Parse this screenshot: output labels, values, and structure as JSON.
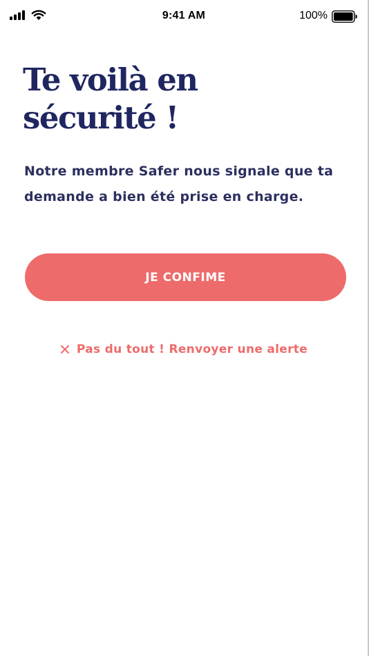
{
  "status_bar": {
    "time": "9:41 AM",
    "battery_percent": "100%",
    "icons": [
      "signal-icon",
      "wifi-icon",
      "battery-icon"
    ]
  },
  "main": {
    "title_line1": "Te voilà en",
    "title_line2": "sécurité !",
    "subtitle": "Notre membre Safer nous signale que ta demande a bien été prise en charge.",
    "confirm_label": "JE CONFIME",
    "resend_label": "Pas du tout ! Renvoyer une alerte",
    "resend_icon": "close-icon"
  },
  "colors": {
    "title": "#1f2660",
    "accent": "#ee6b6b",
    "background": "#ffffff"
  }
}
